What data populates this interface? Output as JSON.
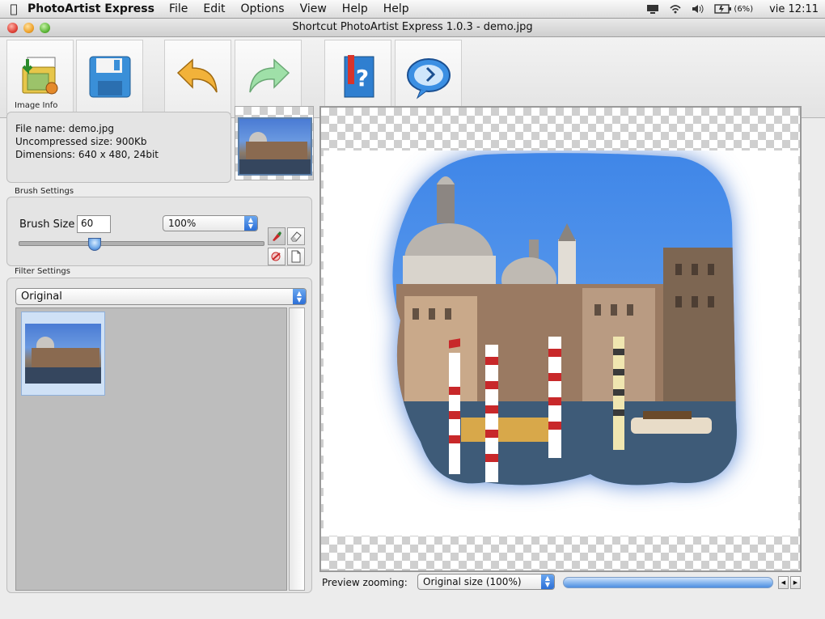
{
  "menubar": {
    "app_name": "PhotoArtist Express",
    "menus": [
      "File",
      "Edit",
      "Options",
      "View",
      "Help",
      "Help"
    ],
    "battery": "(6%)",
    "clock": "vie 12:11"
  },
  "window": {
    "title": "Shortcut PhotoArtist Express 1.0.3 - demo.jpg"
  },
  "toolbar": {
    "buttons": [
      {
        "icon": "open-image-icon"
      },
      {
        "icon": "save-disk-icon"
      },
      {
        "icon": "undo-arrow-icon"
      },
      {
        "icon": "redo-arrow-icon"
      },
      {
        "icon": "help-book-icon"
      },
      {
        "icon": "web-globe-icon"
      }
    ]
  },
  "image_info": {
    "label": "Image Info",
    "file_name": "File name: demo.jpg",
    "uncompressed": "Uncompressed size: 900Kb",
    "dimensions": "Dimensions: 640 x 480, 24bit"
  },
  "brush_settings": {
    "label": "Brush Settings",
    "size_label": "Brush Size",
    "size_value": "60",
    "opacity": "100%",
    "slider_fraction": 0.31
  },
  "filter_settings": {
    "label": "Filter Settings",
    "selected": "Original"
  },
  "preview": {
    "zoom_label": "Preview zooming:",
    "zoom_value": "Original size (100%)"
  }
}
